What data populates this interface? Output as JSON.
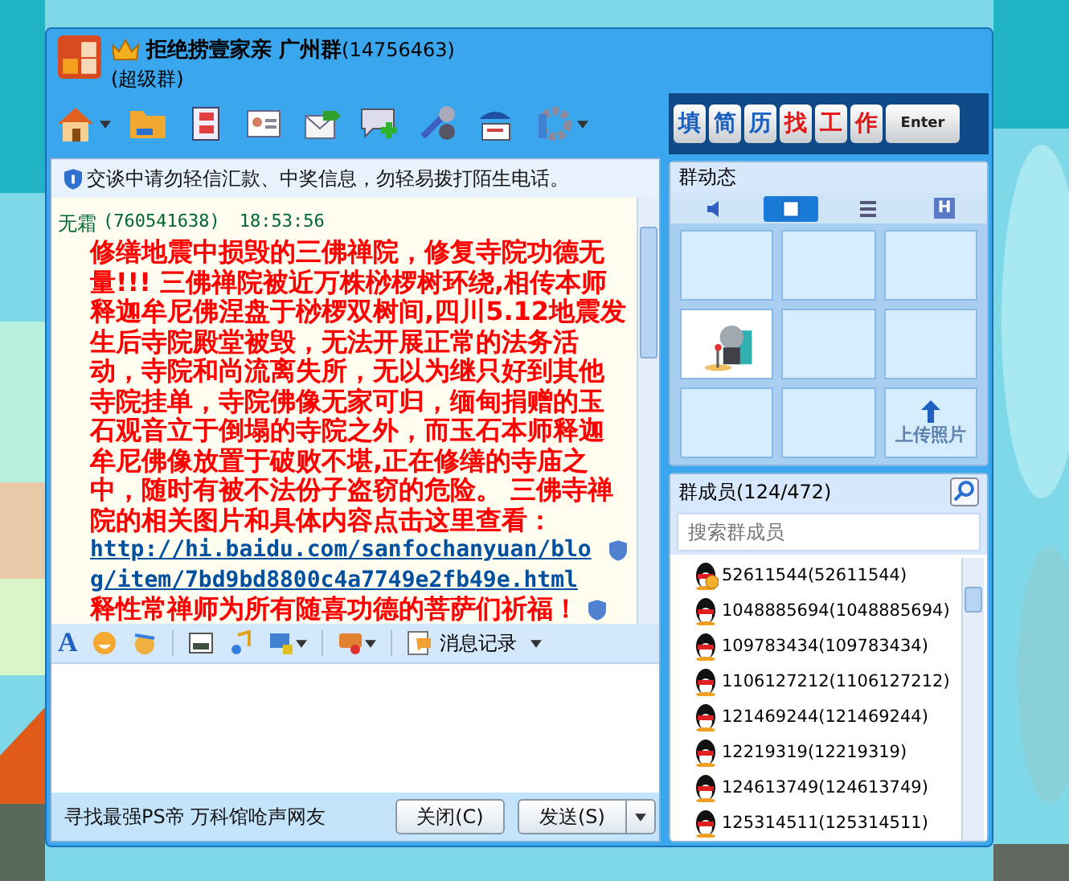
{
  "window": {
    "title": "拒绝捞壹家亲 广州群",
    "group_number": "(14756463)",
    "subtitle": "(超级群)"
  },
  "ad_keys": [
    "填",
    "简",
    "历",
    "找",
    "工",
    "作",
    "Enter"
  ],
  "notice": "交谈中请勿轻信汇款、中奖信息，勿轻易拨打陌生电话。",
  "message": {
    "sender": "无霜",
    "sender_id": "(760541638)",
    "time": "18:53:56",
    "text": "修缮地震中损毁的三佛禅院，修复寺院功德无量!!! 三佛禅院被近万株桫椤树环绕,相传本师释迦牟尼佛涅盘于桫椤双树间,四川5.12地震发生后寺院殿堂被毁，无法开展正常的法务活动，寺院和尚流离失所，无以为继只好到其他寺院挂单，寺院佛像无家可归，缅甸捐赠的玉石观音立于倒塌的寺院之外，而玉石本师释迦牟尼佛像放置于破败不堪,正在修缮的寺庙之中，随时有被不法份子盗窃的危险。 三佛寺禅院的相关图片和具体内容点击这里查看：",
    "link": "http://hi.baidu.com/sanfochanyuan/blog/item/7bd9bd8800c4a7749e2fb49e.html",
    "closing": "释性常禅师为所有随喜功德的菩萨们祈福！"
  },
  "format_toolbar": {
    "font_glyph": "A",
    "history_label": "消息记录"
  },
  "status_text": "寻找最强PS帝 万科馆呛声网友",
  "buttons": {
    "close": "关闭(C)",
    "send": "发送(S)"
  },
  "group_feed": {
    "title": "群动态",
    "view_tabs": [
      {
        "kind": "speaker",
        "selected": false
      },
      {
        "kind": "grid",
        "selected": true
      },
      {
        "kind": "list",
        "selected": false
      },
      {
        "kind": "text",
        "label": "H",
        "selected": false
      }
    ],
    "cells": [
      {
        "kind": "empty"
      },
      {
        "kind": "empty"
      },
      {
        "kind": "empty"
      },
      {
        "kind": "picture"
      },
      {
        "kind": "empty"
      },
      {
        "kind": "empty"
      },
      {
        "kind": "empty"
      },
      {
        "kind": "empty"
      },
      {
        "kind": "upload",
        "label": "上传照片"
      }
    ]
  },
  "members": {
    "title": "群成员",
    "count": "(124/472)",
    "search_placeholder": "搜索群成员",
    "items": [
      {
        "name": "52611544(52611544)",
        "status_badge": true
      },
      {
        "name": "1048885694(1048885694)",
        "status_badge": false
      },
      {
        "name": "109783434(109783434)",
        "status_badge": false
      },
      {
        "name": "1106127212(1106127212)",
        "status_badge": false
      },
      {
        "name": "121469244(121469244)",
        "status_badge": false
      },
      {
        "name": "12219319(12219319)",
        "status_badge": false
      },
      {
        "name": "124613749(124613749)",
        "status_badge": false
      },
      {
        "name": "125314511(125314511)",
        "status_badge": false
      }
    ]
  }
}
